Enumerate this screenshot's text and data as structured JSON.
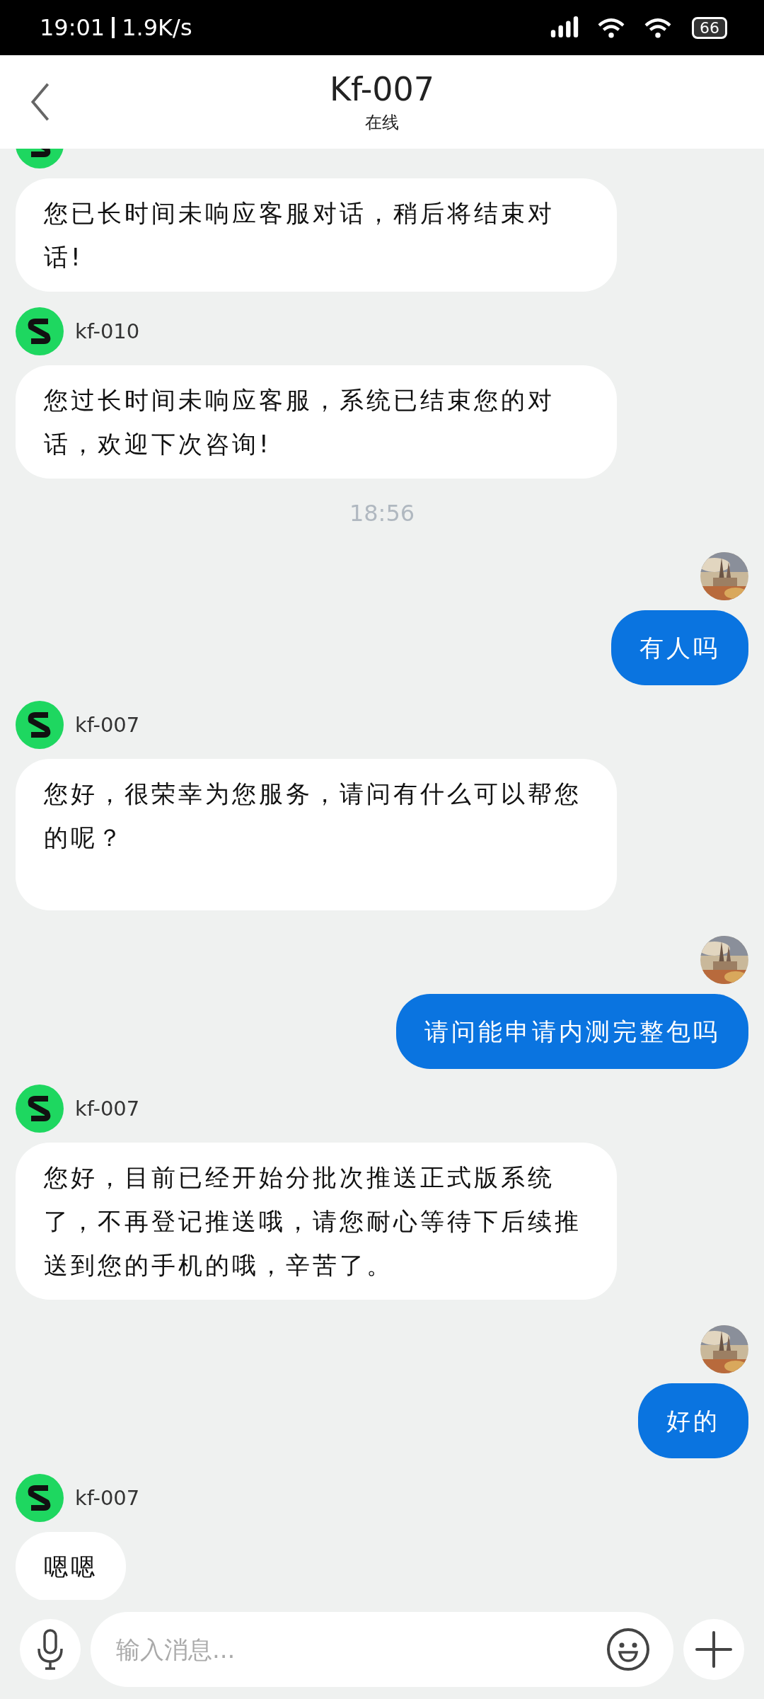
{
  "status_bar": {
    "time": "19:01",
    "speed": "1.9K/s",
    "battery": "66"
  },
  "header": {
    "title": "Kf-007",
    "subtitle": "在线"
  },
  "messages": [
    {
      "kind": "agent",
      "clipped": true,
      "text": "您已长时间未响应客服对话，稍后将结束对话!"
    },
    {
      "kind": "agent",
      "sender": "kf-010",
      "text": "您过长时间未响应客服，系统已结束您的对话，欢迎下次咨询!"
    },
    {
      "kind": "time",
      "text": "18:56"
    },
    {
      "kind": "user",
      "text": "有人吗"
    },
    {
      "kind": "agent",
      "sender": "kf-007",
      "text": "您好，很荣幸为您服务，请问有什么可以帮您的呢？",
      "tall": true
    },
    {
      "kind": "user",
      "text": "请问能申请内测完整包吗"
    },
    {
      "kind": "agent",
      "sender": "kf-007",
      "text": "您好，目前已经开始分批次推送正式版系统了，不再登记推送哦，请您耐心等待下后续推送到您的手机的哦，辛苦了。"
    },
    {
      "kind": "user",
      "text": "好的"
    },
    {
      "kind": "agent",
      "sender": "kf-007",
      "text": "嗯嗯"
    }
  ],
  "input": {
    "placeholder": "输入消息..."
  }
}
